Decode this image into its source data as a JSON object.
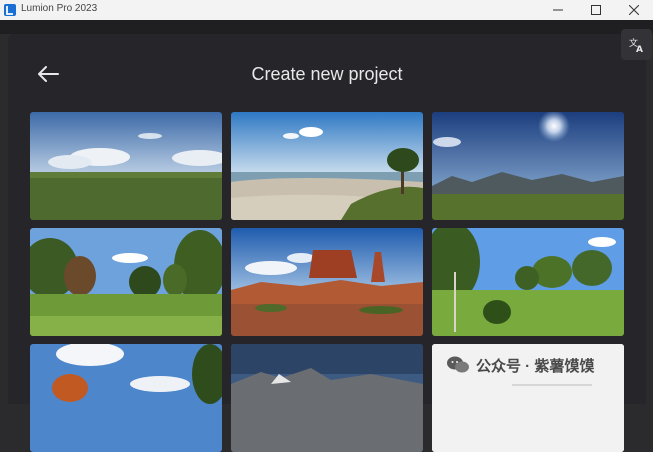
{
  "window": {
    "title": "Lumion Pro 2023"
  },
  "header": {
    "title": "Create new project"
  },
  "templates": [
    {
      "name": "Plain grass field template"
    },
    {
      "name": "Beach with palm tree template"
    },
    {
      "name": "Sunny mountain meadow template"
    },
    {
      "name": "Forest clearing template"
    },
    {
      "name": "Red rock desert template"
    },
    {
      "name": "Tropical palm garden template"
    },
    {
      "name": "Cloudy sky with trees template"
    },
    {
      "name": "Rocky mountain dusk template"
    },
    {
      "name": "Blank white template"
    }
  ],
  "watermark": {
    "text": "公众号 · 紫薯馍馍"
  },
  "colors": {
    "background": "#26262a",
    "titlebar": "#f3f3f3",
    "accent": "#1a6fd4"
  }
}
